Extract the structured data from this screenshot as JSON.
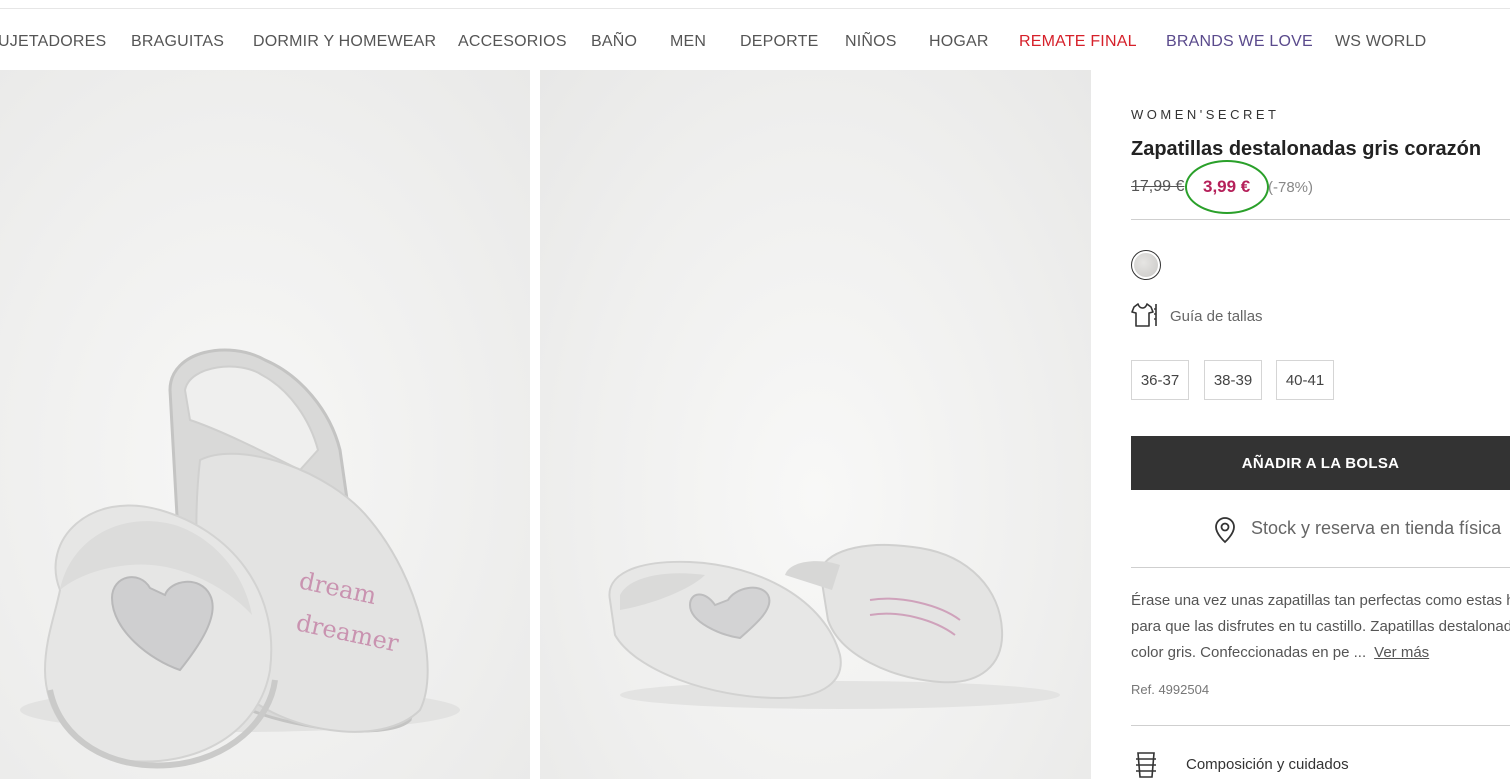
{
  "nav": {
    "items": [
      {
        "label": "UJETADORES"
      },
      {
        "label": "BRAGUITAS"
      },
      {
        "label": "DORMIR Y HOMEWEAR"
      },
      {
        "label": "ACCESORIOS"
      },
      {
        "label": "BAÑO"
      },
      {
        "label": "MEN"
      },
      {
        "label": "DEPORTE"
      },
      {
        "label": "NIÑOS"
      },
      {
        "label": "HOGAR"
      },
      {
        "label": "REMATE FINAL"
      },
      {
        "label": "BRANDS WE LOVE"
      },
      {
        "label": "WS WORLD"
      }
    ]
  },
  "gallery": {
    "left_embroidery": [
      "dream",
      "dreamer"
    ]
  },
  "product": {
    "brand": "WOMEN'SECRET",
    "title": "Zapatillas destalonadas gris corazón",
    "old_price": "17,99 €",
    "price": "3,99 €",
    "discount": "(-78%)",
    "size_guide": "Guía de tallas",
    "sizes": [
      "36-37",
      "38-39",
      "40-41"
    ],
    "add_to_bag": "AÑADIR A LA BOLSA",
    "stock": "Stock y reserva en tienda física",
    "description_lines": [
      "Érase una vez unas zapatillas tan perfectas como estas h",
      "para que las disfrutes en tu castillo. Zapatillas destalonad",
      "color gris. Confeccionadas en pe ..."
    ],
    "ver_mas": "Ver más",
    "ref": "Ref. 4992504",
    "composition": "Composición y cuidados"
  },
  "colors": {
    "sale": "#d6202a",
    "brands": "#5a4a8c",
    "price": "#b5205a",
    "button": "#333333",
    "annotation_circle": "#2aa02a"
  },
  "icons": {
    "size_guide": "tshirt-ruler-icon",
    "stock": "location-pin-icon",
    "composition": "washing-care-icon",
    "swatch": "grey-color-swatch"
  }
}
